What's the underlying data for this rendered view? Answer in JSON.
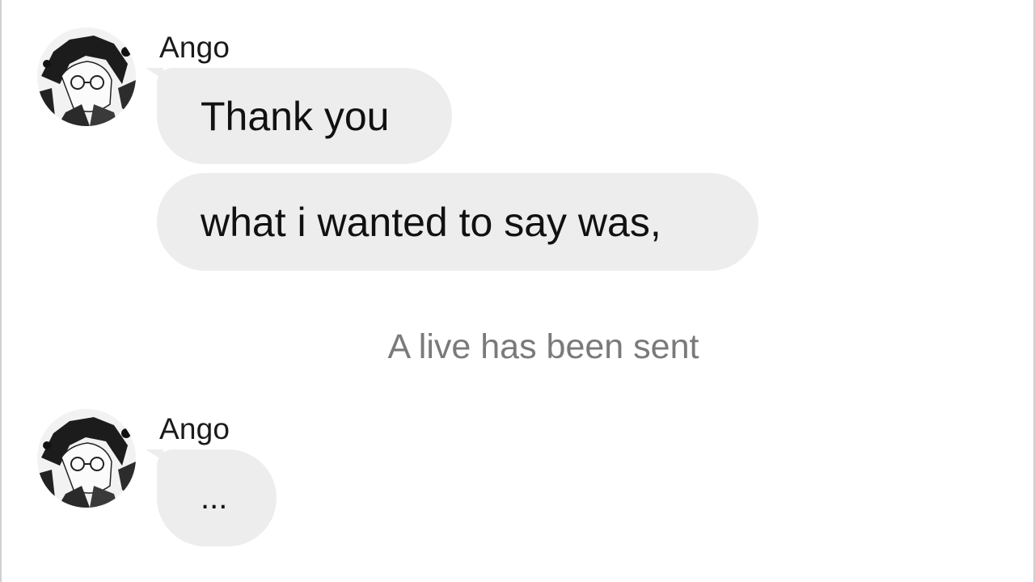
{
  "messages": [
    {
      "sender": "Ango",
      "bubbles": [
        "Thank you",
        "what i wanted to say was,"
      ]
    },
    {
      "sender": "Ango",
      "bubbles": [
        "..."
      ]
    }
  ],
  "system_notice": "A live has been sent",
  "colors": {
    "bubble": "#ededed",
    "text": "#111111",
    "system_text": "#7a7a7a",
    "background": "#ffffff"
  },
  "icons": {
    "avatar": "manga-character-avatar"
  }
}
